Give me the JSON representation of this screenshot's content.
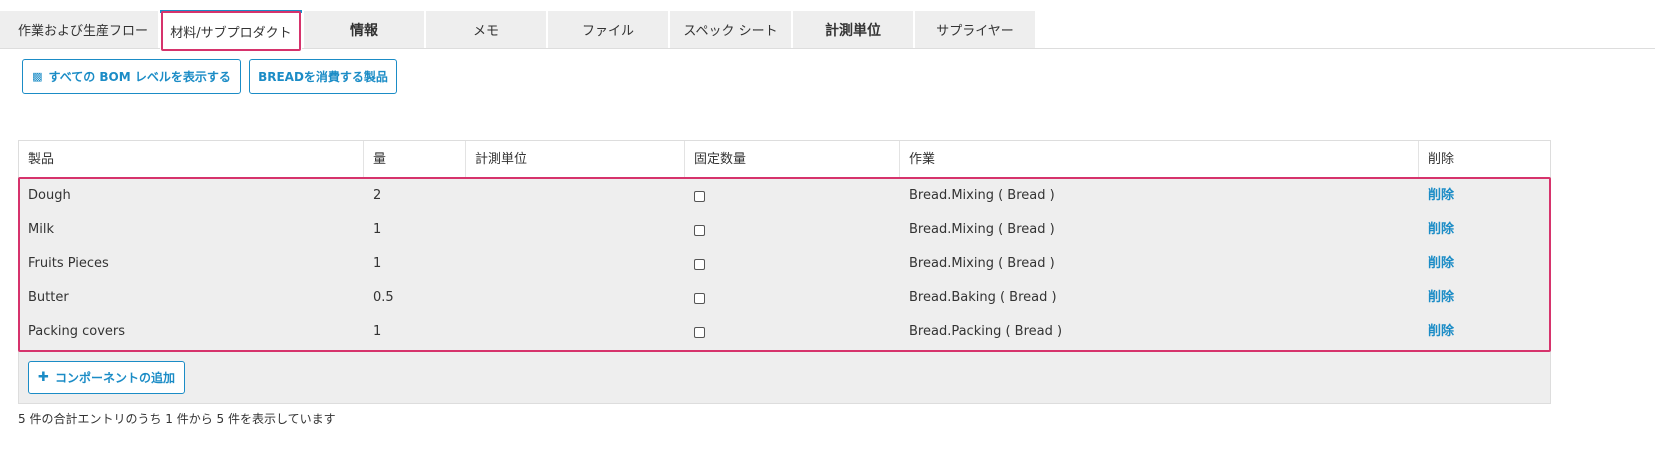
{
  "tabs": [
    {
      "label": "作業および生産フロー"
    },
    {
      "label": "材料/サブプロダクト"
    },
    {
      "label": "情報"
    },
    {
      "label": "メモ"
    },
    {
      "label": "ファイル"
    },
    {
      "label": "スペック シート"
    },
    {
      "label": "計測単位"
    },
    {
      "label": "サプライヤー"
    }
  ],
  "toolbar": {
    "show_bom_label": "すべての BOM レベルを表示する",
    "consuming_label": "BREADを消費する製品"
  },
  "table": {
    "headers": [
      "製品",
      "量",
      "計測単位",
      "固定数量",
      "作業",
      "削除"
    ],
    "rows": [
      {
        "product": "Dough",
        "qty": "2",
        "uom": "",
        "operation": "Bread.Mixing ( Bread )",
        "delete": "削除"
      },
      {
        "product": "Milk",
        "qty": "1",
        "uom": "",
        "operation": "Bread.Mixing ( Bread )",
        "delete": "削除"
      },
      {
        "product": "Fruits Pieces",
        "qty": "1",
        "uom": "",
        "operation": "Bread.Mixing ( Bread )",
        "delete": "削除"
      },
      {
        "product": "Butter",
        "qty": "0.5",
        "uom": "",
        "operation": "Bread.Baking ( Bread )",
        "delete": "削除"
      },
      {
        "product": "Packing covers",
        "qty": "1",
        "uom": "",
        "operation": "Bread.Packing ( Bread )",
        "delete": "削除"
      }
    ],
    "add_component_label": "コンポーネントの追加"
  },
  "footer": {
    "entries_text": "5 件の合計エントリのうち 1 件から 5 件を表示しています"
  },
  "colors": {
    "accent": "#1b8cc6",
    "highlight": "#d6336c",
    "row_bg": "#eeeeee"
  }
}
